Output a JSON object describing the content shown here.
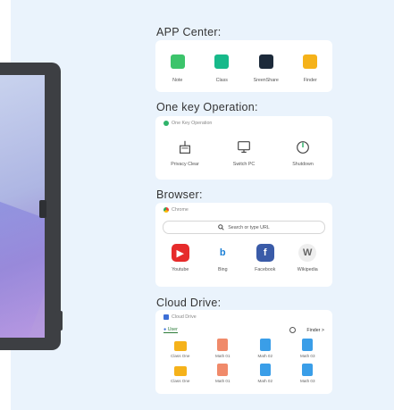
{
  "sections": {
    "app_center": "APP Center:",
    "one_key": "One key Operation:",
    "browser": "Browser:",
    "cloud_drive": "Cloud Drive:"
  },
  "app_center": {
    "apps": [
      {
        "label": "Note",
        "icon": "note-icon",
        "color": "#3cc46b"
      },
      {
        "label": "Class",
        "icon": "class-icon",
        "color": "#17b98a"
      },
      {
        "label": "SreenShare",
        "icon": "screenshare-icon",
        "color": "#1c2a3a"
      },
      {
        "label": "Finder",
        "icon": "folder-icon",
        "color": "#f5b21a"
      }
    ]
  },
  "one_key": {
    "header": "One Key Operation",
    "items": [
      {
        "label": "Privacy Clear",
        "icon": "broom-icon"
      },
      {
        "label": "Switch PC",
        "icon": "monitor-icon"
      },
      {
        "label": "Shutdown",
        "icon": "power-icon"
      }
    ]
  },
  "browser": {
    "header": "Chrome",
    "search_placeholder": "Search or type URL",
    "sites": [
      {
        "label": "Youtube",
        "glyph": "▶",
        "color": "#e62b2b"
      },
      {
        "label": "Bing",
        "glyph": "b",
        "color": "#ffffff"
      },
      {
        "label": "Facebook",
        "glyph": "f",
        "color": "#3a5ba8"
      },
      {
        "label": "Wikipedia",
        "glyph": "W",
        "color": "#eeeeee"
      }
    ]
  },
  "cloud": {
    "header": "Cloud Drive",
    "user": "User",
    "finder": "Finder >",
    "files": [
      {
        "label": "Class One",
        "type": "folder"
      },
      {
        "label": "Math 01",
        "type": "pdf"
      },
      {
        "label": "Math 02",
        "type": "doc"
      },
      {
        "label": "Math 03",
        "type": "doc"
      },
      {
        "label": "Class One",
        "type": "folder"
      },
      {
        "label": "Math 01",
        "type": "pdf"
      },
      {
        "label": "Math 02",
        "type": "doc"
      },
      {
        "label": "Math 03",
        "type": "doc"
      }
    ]
  }
}
